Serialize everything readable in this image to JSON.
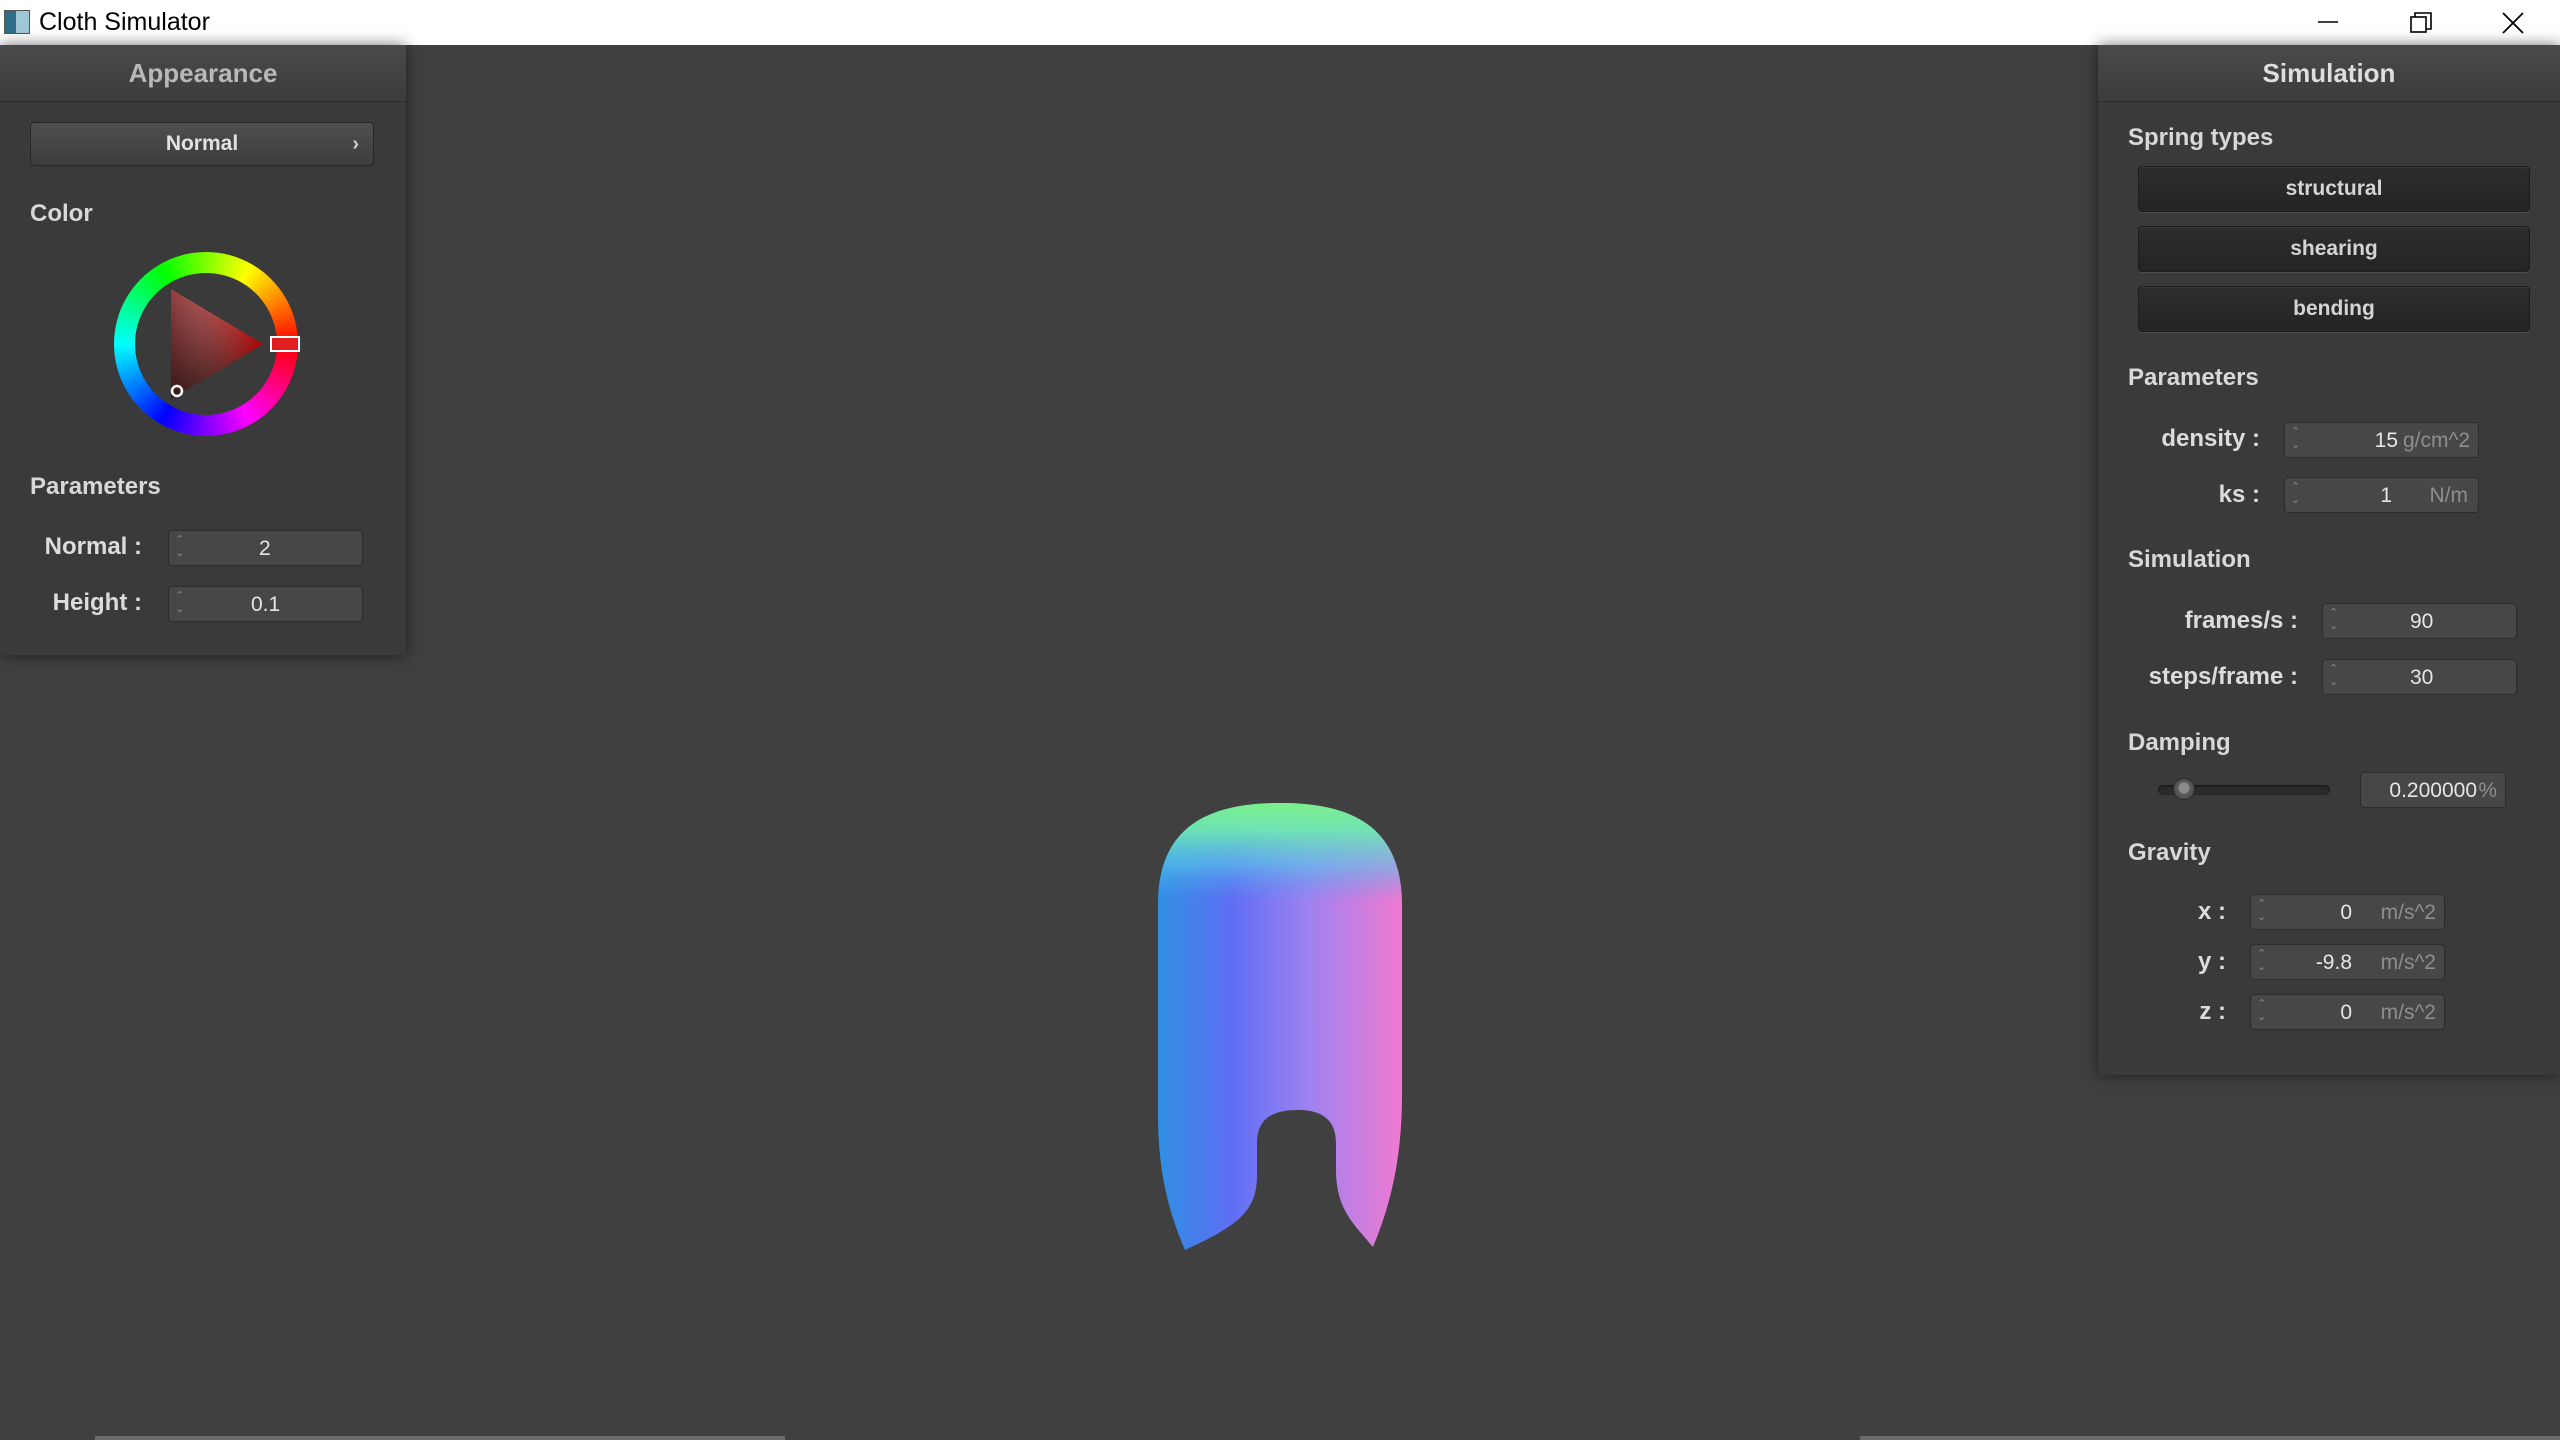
{
  "window": {
    "title": "Cloth Simulator",
    "controls": [
      "minimize-icon",
      "maximize-icon",
      "close-icon"
    ]
  },
  "appearance": {
    "header": "Appearance",
    "shader_dropdown": {
      "value": "Normal",
      "icon": "chevron-right-icon"
    },
    "color_label": "Color",
    "color_wheel": {
      "selected_color": "#e02020"
    },
    "parameters_label": "Parameters",
    "fields": [
      {
        "label": "Normal :",
        "value": "2"
      },
      {
        "label": "Height :",
        "value": "0.1"
      }
    ]
  },
  "simulation": {
    "header": "Simulation",
    "spring_types_label": "Spring types",
    "spring_buttons": [
      "structural",
      "shearing",
      "bending"
    ],
    "parameters_label": "Parameters",
    "parameters": [
      {
        "label": "density :",
        "value": "15",
        "unit": "g/cm^2"
      },
      {
        "label": "ks :",
        "value": "1",
        "unit": "N/m"
      }
    ],
    "simulation_label": "Simulation",
    "sim_fields": [
      {
        "label": "frames/s :",
        "value": "90"
      },
      {
        "label": "steps/frame :",
        "value": "30"
      }
    ],
    "damping_label": "Damping",
    "damping": {
      "value": "0.200000",
      "unit": "%",
      "slider_fraction": 0.1
    },
    "gravity_label": "Gravity",
    "gravity": [
      {
        "label": "x :",
        "value": "0",
        "unit": "m/s^2"
      },
      {
        "label": "y :",
        "value": "-9.8",
        "unit": "m/s^2"
      },
      {
        "label": "z :",
        "value": "0",
        "unit": "m/s^2"
      }
    ]
  },
  "colors": {
    "background": "#404040",
    "panel": "#3a3a3a",
    "selected_hue": "#ff0000"
  }
}
